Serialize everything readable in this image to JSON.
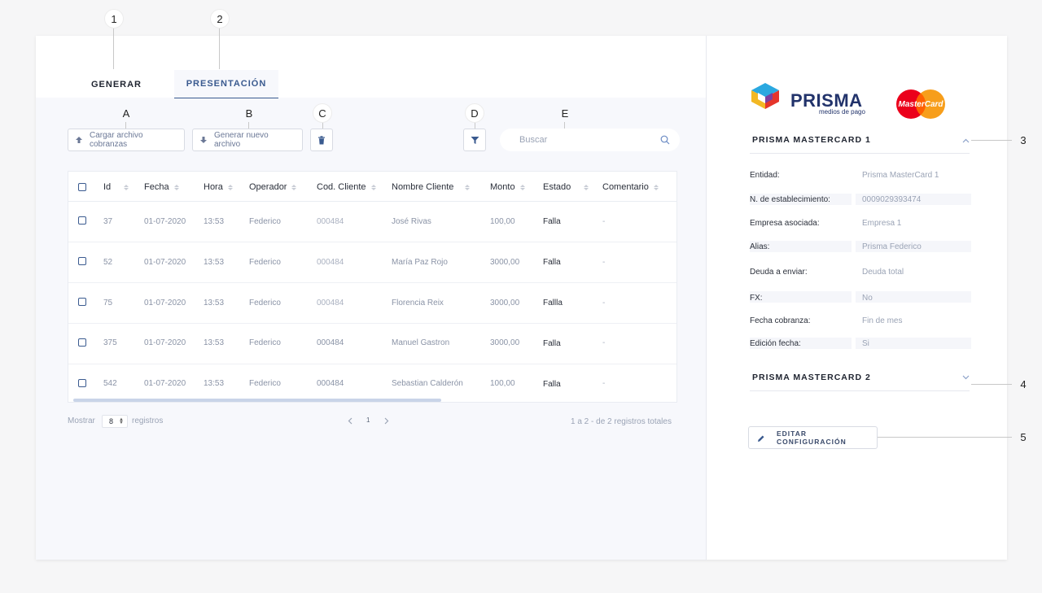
{
  "markers": {
    "m1": "1",
    "m2": "2",
    "m3": "3",
    "m4": "4",
    "m5": "5",
    "mA": "A",
    "mB": "B",
    "mC": "C",
    "mD": "D",
    "mE": "E"
  },
  "tabs": {
    "generar": "GENERAR",
    "presentacion": "PRESENTACIÓN"
  },
  "toolbar": {
    "upload_label": "Cargar archivo cobranzas",
    "generate_label": "Generar nuevo archivo",
    "search_placeholder": "Buscar"
  },
  "table": {
    "headers": [
      "Id",
      "Fecha",
      "Hora",
      "Operador",
      "Cod. Cliente",
      "Nombre Cliente",
      "Monto",
      "Estado",
      "Comentario"
    ],
    "rows": [
      {
        "id": "37",
        "fecha": "01-07-2020",
        "hora": "13:53",
        "operador": "Federico",
        "cod": "000484",
        "nombre": "José Rivas",
        "monto": "100,00",
        "estado": "Falla",
        "comentario": "-"
      },
      {
        "id": "52",
        "fecha": "01-07-2020",
        "hora": "13:53",
        "operador": "Federico",
        "cod": "000484",
        "nombre": "María Paz Rojo",
        "monto": "3000,00",
        "estado": "Falla",
        "comentario": "-"
      },
      {
        "id": "75",
        "fecha": "01-07-2020",
        "hora": "13:53",
        "operador": "Federico",
        "cod": "000484",
        "nombre": "Florencia Reix",
        "monto": "3000,00",
        "estado": "Fallla",
        "comentario": "-"
      },
      {
        "id": "375",
        "fecha": "01-07-2020",
        "hora": "13:53",
        "operador": "Federico",
        "cod": "000484",
        "nombre": "Manuel Gastron",
        "monto": "3000,00",
        "estado": "Falla",
        "comentario": "-"
      },
      {
        "id": "542",
        "fecha": "01-07-2020",
        "hora": "13:53",
        "operador": "Federico",
        "cod": "000484",
        "nombre": "Sebastian Calderón",
        "monto": "100,00",
        "estado": "Falla",
        "comentario": "-"
      }
    ]
  },
  "pagination": {
    "show_label": "Mostrar",
    "page_size": "8",
    "records_label": "registros",
    "current_page": "1",
    "summary": "1 a 2 - de 2 registros totales"
  },
  "brand": {
    "prisma": "PRISMA",
    "prisma_sub": "medios de pago",
    "mastercard": "MasterCard"
  },
  "config": {
    "section1_title": "PRISMA MASTERCARD 1",
    "section2_title": "PRISMA MASTERCARD 2",
    "fields": [
      {
        "label": "Entidad:",
        "value": "Prisma MasterCard 1"
      },
      {
        "label": "N. de establecimiento:",
        "value": "0009029393474"
      },
      {
        "label": "Empresa asociada:",
        "value": "Empresa 1"
      },
      {
        "label": "Alias:",
        "value": "Prisma Federico"
      },
      {
        "label": "Deuda a enviar:",
        "value": "Deuda total"
      },
      {
        "label": "FX:",
        "value": "No"
      },
      {
        "label": "Fecha cobranza:",
        "value": "Fin de mes"
      },
      {
        "label": "Edición fecha:",
        "value": "Si"
      }
    ],
    "edit_label": "EDITAR CONFIGURACIÓN"
  },
  "colors": {
    "accent": "#3a5a8f",
    "brand_navy": "#22336b",
    "mc_red": "#eb001b",
    "mc_orange": "#f79e1b"
  }
}
